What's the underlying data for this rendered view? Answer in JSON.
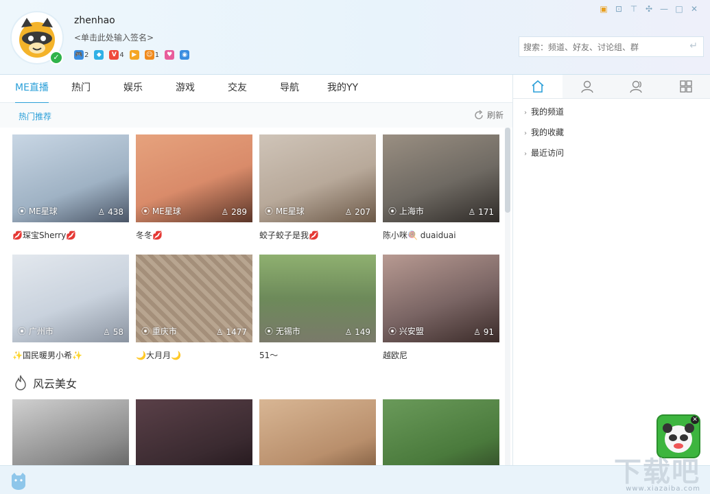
{
  "header": {
    "username": "zhenhao",
    "signature": "<单击此处输入签名>",
    "badges": [
      {
        "icon": "game-badge-icon",
        "count": "2",
        "color": "#3a8de0"
      },
      {
        "icon": "diamond-badge-icon",
        "count": "",
        "color": "#2fb0e6"
      },
      {
        "icon": "vip-badge-icon",
        "label": "V",
        "count": "4",
        "color": "#ef4a3b"
      },
      {
        "icon": "play-badge-icon",
        "count": "",
        "color": "#f5a623"
      },
      {
        "icon": "face-badge-icon",
        "count": "1",
        "color": "#f08a1c"
      },
      {
        "icon": "heart-badge-icon",
        "count": "",
        "color": "#e85d9b"
      },
      {
        "icon": "eye-badge-icon",
        "count": "",
        "color": "#3a8de0"
      }
    ],
    "search_placeholder": "搜索：频道、好友、讨论组、群"
  },
  "tabs": [
    "ME直播",
    "热门",
    "娱乐",
    "游戏",
    "交友",
    "导航",
    "我的YY"
  ],
  "subbar": {
    "hot_label": "热门推荐",
    "refresh_label": "刷新"
  },
  "cards": [
    {
      "loc": "ME星球",
      "viewers": "438",
      "name": "💋琛宝Sherry💋",
      "color": "#9fb2c4"
    },
    {
      "loc": "ME星球",
      "viewers": "289",
      "name": "冬冬💋",
      "color": "#d98b6a"
    },
    {
      "loc": "ME星球",
      "viewers": "207",
      "name": "蛟子蛟子是我💋",
      "color": "#b8a99a"
    },
    {
      "loc": "上海市",
      "viewers": "171",
      "name": "陈小咪🍭       duaiduai",
      "color": "#6f6a63"
    },
    {
      "loc": "广州市",
      "viewers": "58",
      "name": "✨国民暖男小希✨",
      "color": "#c9d2dd"
    },
    {
      "loc": "重庆市",
      "viewers": "1477",
      "name": "🌙大月月🌙",
      "color": "#a48f7a"
    },
    {
      "loc": "无锡市",
      "viewers": "149",
      "name": "51～",
      "color": "#6d8a5a"
    },
    {
      "loc": "兴安盟",
      "viewers": "91",
      "name": "越欧尼",
      "color": "#7a6564"
    }
  ],
  "section_title": "风云美女",
  "section_cards": [
    {
      "color": "#8c8c8c"
    },
    {
      "color": "#3a2a30"
    },
    {
      "color": "#b98f6c"
    },
    {
      "color": "#4a7a3c"
    }
  ],
  "right_tabs": [
    "home-icon",
    "person-icon",
    "contacts-icon",
    "apps-grid-icon"
  ],
  "right_items": [
    "我的频道",
    "我的收藏",
    "最近访问"
  ],
  "watermark": {
    "big": "下载吧",
    "small": "www.xiazaiba.com"
  },
  "colors": {
    "accent": "#2a9fd8",
    "online": "#2fb34a"
  }
}
